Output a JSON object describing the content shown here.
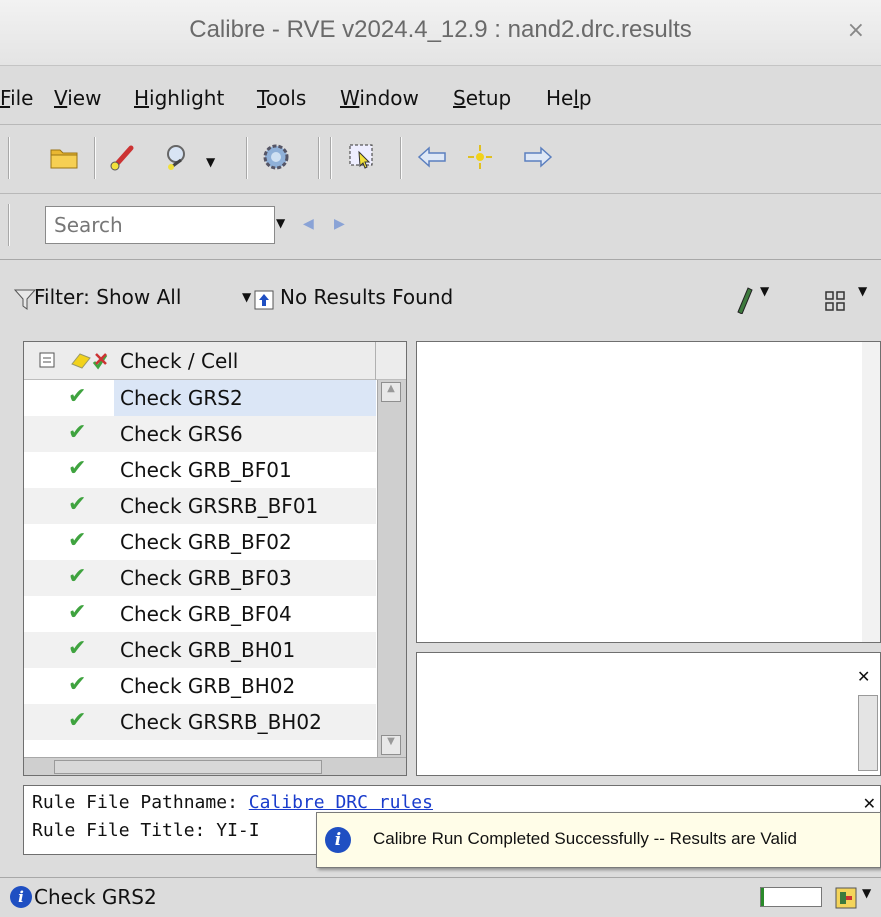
{
  "window": {
    "title": "Calibre - RVE v2024.4_12.9 : nand2.drc.results",
    "close_glyph": "×"
  },
  "menu": [
    {
      "label": "File",
      "mnemonic": "F",
      "rest": "ile"
    },
    {
      "label": "View",
      "mnemonic": "V",
      "rest": "iew"
    },
    {
      "label": "Highlight",
      "mnemonic": "H",
      "rest": "ighlight"
    },
    {
      "label": "Tools",
      "mnemonic": "T",
      "rest": "ools"
    },
    {
      "label": "Window",
      "mnemonic": "W",
      "rest": "indow"
    },
    {
      "label": "Setup",
      "mnemonic": "S",
      "rest": "etup"
    },
    {
      "label": "Help",
      "pre": "He",
      "mnemonic": "l",
      "rest": "p"
    }
  ],
  "toolbar": {
    "icons": [
      "open-folder-icon",
      "highlight-brush-icon",
      "zoom-icon",
      "settings-gear-icon",
      "highlight-select-icon",
      "previous-arrow-icon",
      "highlight-center-icon",
      "next-arrow-icon"
    ]
  },
  "search": {
    "placeholder": "Search"
  },
  "filterbar": {
    "filter_label": "Filter: Show All",
    "results_label": "No Results Found"
  },
  "tree": {
    "header": "Check / Cell",
    "rows": [
      {
        "label": "Check GRS2",
        "selected": true
      },
      {
        "label": "Check GRS6"
      },
      {
        "label": "Check GRB_BF01"
      },
      {
        "label": "Check GRSRB_BF01"
      },
      {
        "label": "Check GRB_BF02"
      },
      {
        "label": "Check GRB_BF03"
      },
      {
        "label": "Check GRB_BF04"
      },
      {
        "label": "Check GRB_BH01"
      },
      {
        "label": "Check GRB_BH02"
      },
      {
        "label": "Check GRSRB_BH02"
      }
    ],
    "trunc_char": "("
  },
  "rule_info": {
    "pathname_label": "Rule File Pathname:",
    "pathname_link": "Calibre DRC rules",
    "title_label": "Rule File Title:",
    "title_value": "YI-I"
  },
  "toast": {
    "message": "Calibre Run Completed Successfully -- Results are Valid"
  },
  "status": {
    "text": "Check GRS2",
    "progress": 0.05
  },
  "colors": {
    "check": "#3fa33f",
    "info": "#1f4fc2",
    "link": "#1a3ccc",
    "selected_row": "#dbe6f6"
  }
}
